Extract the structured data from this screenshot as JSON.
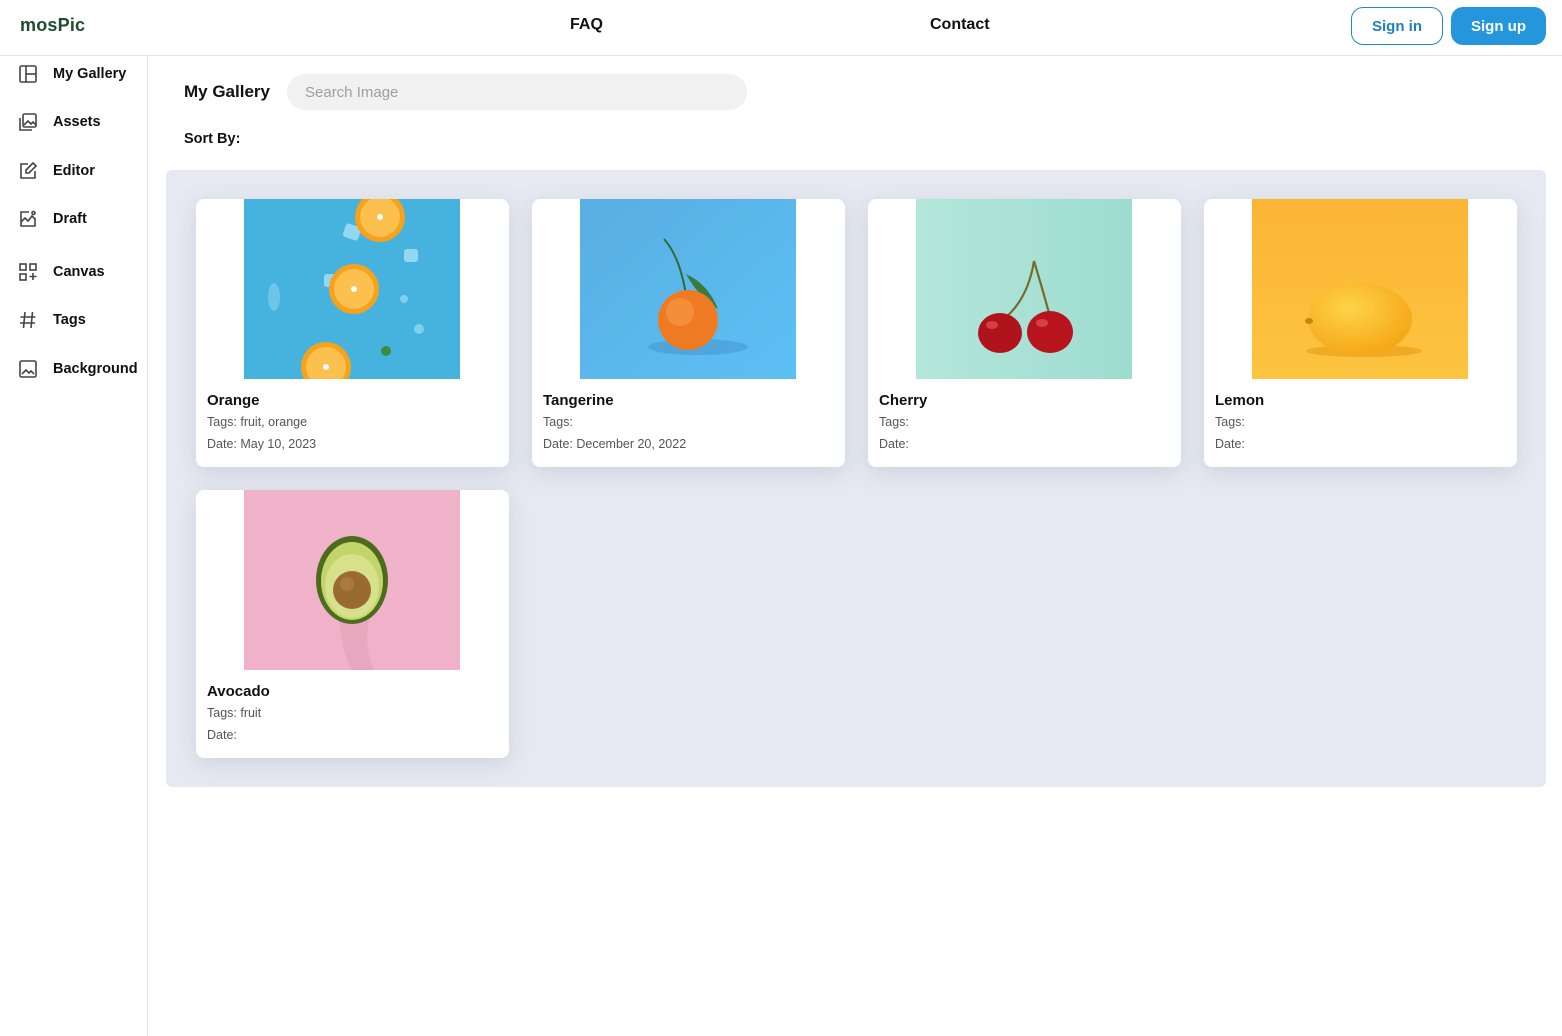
{
  "header": {
    "brand": "mosPic",
    "nav": {
      "faq": "FAQ",
      "contact": "Contact"
    },
    "signin_label": "Sign in",
    "signup_label": "Sign up"
  },
  "sidebar": {
    "items": [
      {
        "label": "My Gallery",
        "icon": "layout-icon"
      },
      {
        "label": "Assets",
        "icon": "images-icon"
      },
      {
        "label": "Editor",
        "icon": "edit-icon"
      },
      {
        "label": "Draft",
        "icon": "chart-image-icon"
      },
      {
        "label": "Canvas",
        "icon": "grid-plus-icon"
      },
      {
        "label": "Tags",
        "icon": "hash-icon"
      },
      {
        "label": "Background",
        "icon": "image-icon"
      }
    ]
  },
  "main": {
    "title": "My Gallery",
    "search": {
      "placeholder": "Search Image",
      "value": ""
    },
    "sort_label": "Sort By:"
  },
  "gallery": {
    "cards": [
      {
        "title": "Orange",
        "tags": "Tags: fruit, orange",
        "date": "Date: May 10, 2023",
        "image": "orange-slices-photo"
      },
      {
        "title": "Tangerine",
        "tags": "Tags:",
        "date": "Date: December 20, 2022",
        "image": "tangerine-photo"
      },
      {
        "title": "Cherry",
        "tags": "Tags:",
        "date": "Date:",
        "image": "cherry-photo"
      },
      {
        "title": "Lemon",
        "tags": "Tags:",
        "date": "Date:",
        "image": "lemon-photo"
      },
      {
        "title": "Avocado",
        "tags": "Tags: fruit",
        "date": "Date:",
        "image": "avocado-photo"
      }
    ]
  },
  "colors": {
    "brand": "#1f4d2b",
    "primary": "#2596db",
    "gallery_bg": "#e6e9f1"
  }
}
